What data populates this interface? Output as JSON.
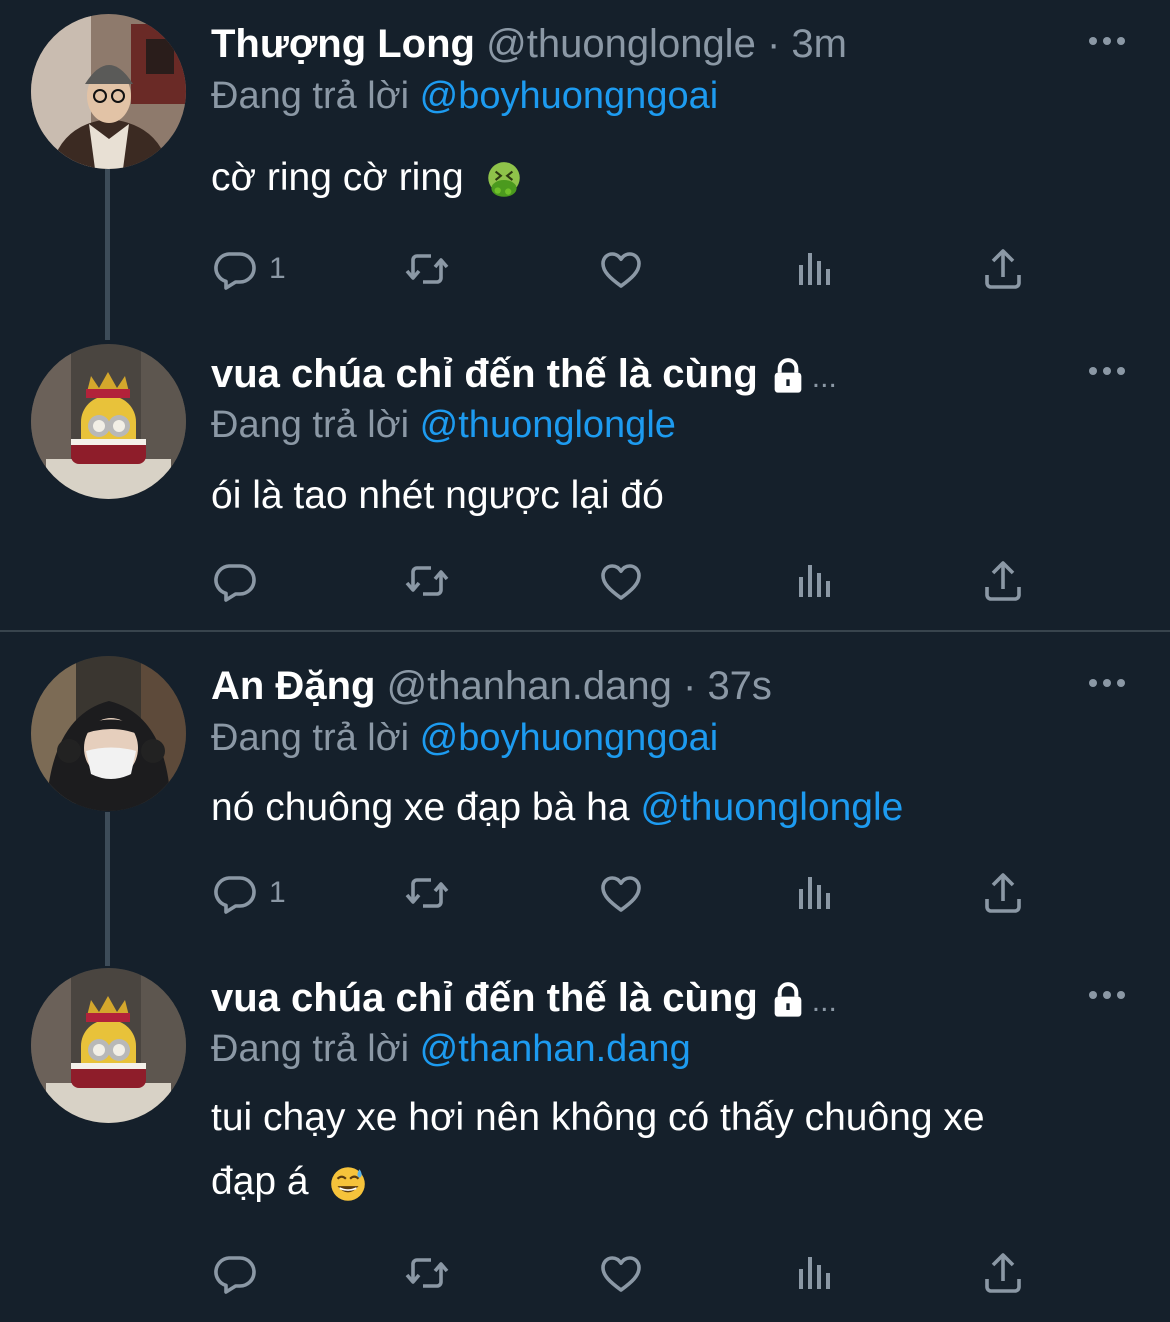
{
  "tweets": [
    {
      "name": "Thượng Long",
      "handle": "@thuonglongle",
      "dot": "·",
      "time": "3m",
      "reply_label": "Đang trả lời",
      "reply_to": "@boyhuongngoai",
      "text": "cờ ring cờ ring",
      "emoji": "nauseated-face",
      "reply_count": "1",
      "avatar_icon": "avatar-person-beanie"
    },
    {
      "name": "vua chúa chỉ đến thế là cùng",
      "ellipsis": "...",
      "reply_label": "Đang trả lời",
      "reply_to": "@thuonglongle",
      "text": "ói là tao nhét ngược lại đó",
      "reply_count": "",
      "avatar_icon": "avatar-minion-king"
    },
    {
      "name": "An Đặng",
      "handle": "@thanhan.dang",
      "dot": "·",
      "time": "37s",
      "reply_label": "Đang trả lời",
      "reply_to": "@boyhuongngoai",
      "text": "nó chuông xe đạp bà ha",
      "text_mention": "@thuonglongle",
      "reply_count": "1",
      "avatar_icon": "avatar-person-hood-mask"
    },
    {
      "name": "vua chúa chỉ đến thế là cùng",
      "ellipsis": "...",
      "reply_label": "Đang trả lời",
      "reply_to": "@thanhan.dang",
      "text_line1": "tui chạy xe hơi nên không có thấy chuông xe",
      "text_line2": "đạp á",
      "emoji": "grinning-face-with-sweat",
      "reply_count": "",
      "avatar_icon": "avatar-minion-king"
    }
  ],
  "colors": {
    "background": "#15202b",
    "accent": "#1d9bf0",
    "secondary_text": "#8b98a5",
    "thread_line": "#3d4c59"
  },
  "icons": [
    "reply-icon",
    "retweet-icon",
    "like-icon",
    "views-icon",
    "share-icon",
    "more-icon",
    "lock-icon"
  ]
}
